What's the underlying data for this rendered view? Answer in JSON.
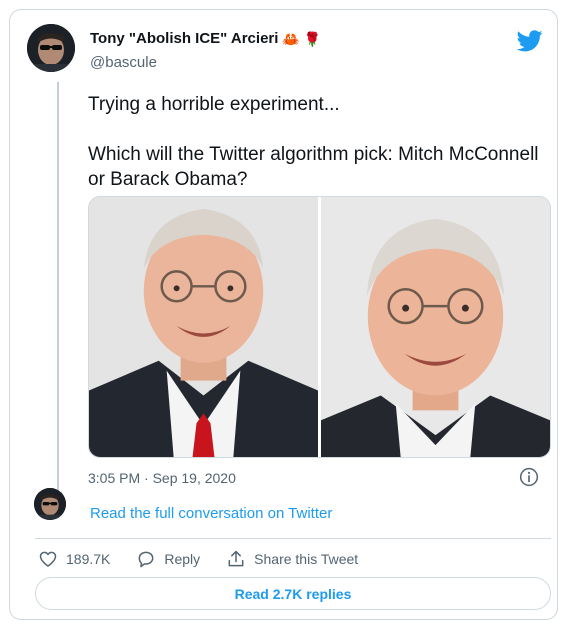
{
  "author": {
    "display_name": "Tony \"Abolish ICE\" Arcieri",
    "emojis": [
      "🦀",
      "🌹"
    ],
    "handle": "@bascule",
    "avatar_icon": "profile-avatar-icon"
  },
  "brand": {
    "icon": "twitter-bird-icon",
    "color": "#1d9bf0"
  },
  "tweet": {
    "line1": "Trying a horrible experiment...",
    "line2": "Which will the Twitter algorithm pick: Mitch McConnell or Barack Obama?",
    "timestamp": "3:05 PM · Sep 19, 2020"
  },
  "conversation": {
    "link_text": "Read the full conversation on Twitter"
  },
  "actions": {
    "like_count": "189.7K",
    "reply_label": "Reply",
    "share_label": "Share this Tweet"
  },
  "replies_button": {
    "label": "Read 2.7K replies"
  },
  "colors": {
    "text": "#0f1419",
    "secondary": "#536471",
    "link": "#1d9bf0",
    "border": "#cfd9de"
  }
}
